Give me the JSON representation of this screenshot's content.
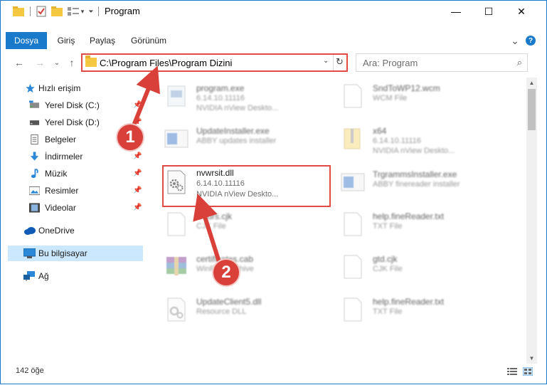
{
  "window": {
    "title": "Program",
    "minimize_glyph": "—",
    "maximize_glyph": "☐",
    "close_glyph": "✕"
  },
  "ribbon": {
    "tabs": [
      "Dosya",
      "Giriş",
      "Paylaş",
      "Görünüm"
    ],
    "accent": "#1979ca",
    "expand_glyph": "⌄",
    "help_glyph": "?"
  },
  "nav": {
    "back_glyph": "←",
    "forward_glyph": "→",
    "recent_glyph": "⌄",
    "up_glyph": "↑",
    "address": "C:\\Program Files\\Program Dizini",
    "address_dropdown_glyph": "⌄",
    "refresh_glyph": "↻",
    "search_placeholder": "Ara: Program",
    "search_glyph": "⌕"
  },
  "sidebar": {
    "items": [
      {
        "label": "Hızlı erişim",
        "icon": "star-icon"
      },
      {
        "label": "Yerel Disk (C:)",
        "icon": "drive-icon",
        "pinned": true
      },
      {
        "label": "Yerel Disk (D:)",
        "icon": "drive-icon",
        "pinned": true
      },
      {
        "label": "Belgeler",
        "icon": "documents-icon",
        "pinned": true
      },
      {
        "label": "İndirmeler",
        "icon": "download-icon",
        "pinned": true
      },
      {
        "label": "Müzik",
        "icon": "music-icon",
        "pinned": true
      },
      {
        "label": "Resimler",
        "icon": "pictures-icon",
        "pinned": true
      },
      {
        "label": "Videolar",
        "icon": "video-icon",
        "pinned": true
      },
      {
        "label": "OneDrive",
        "icon": "cloud-icon"
      },
      {
        "label": "Bu bilgisayar",
        "icon": "computer-icon",
        "selected": true
      },
      {
        "label": "Ağ",
        "icon": "network-icon"
      }
    ],
    "pin_glyph": "📌"
  },
  "files": {
    "left": [
      {
        "name": "program.exe",
        "line2": "6.14.10.11116",
        "line3": "NVIDIA nView Deskto...",
        "icon": "exe-icon"
      },
      {
        "name": "UpdateInstaller.exe",
        "line2": "ABBY updates installer",
        "line3": "",
        "icon": "installer-icon"
      },
      {
        "name": "nvwrsit.dll",
        "line2": "6.14.10.11116",
        "line3": "NVIDIA nView Deskto...",
        "icon": "dll-gear-icon",
        "highlighted": true
      },
      {
        "name": "Cours.cjk",
        "line2": "CJK File",
        "line3": "",
        "icon": "blank-file-icon"
      },
      {
        "name": "certificates.cab",
        "line2": "WinRAR archive",
        "line3": "",
        "icon": "rar-icon"
      },
      {
        "name": "UpdateClient5.dll",
        "line2": "Resource DLL",
        "line3": "",
        "icon": "dll-gear-icon"
      }
    ],
    "right": [
      {
        "name": "SndToWP12.wcm",
        "line2": "WCM File",
        "line3": "",
        "icon": "blank-file-icon"
      },
      {
        "name": "x64",
        "line2": "6.14.10.11116",
        "line3": "NVIDIA nView Deskto...",
        "icon": "zip-folder-icon"
      },
      {
        "name": "TrgrammsInstaller.exe",
        "line2": "ABBY finereader installer",
        "line3": "",
        "icon": "installer-icon"
      },
      {
        "name": "help.fineReader.txt",
        "line2": "TXT File",
        "line3": "",
        "icon": "blank-file-icon"
      },
      {
        "name": "gtd.cjk",
        "line2": "CJK File",
        "line3": "",
        "icon": "blank-file-icon"
      },
      {
        "name": "help.fineReader.txt",
        "line2": "TXT File",
        "line3": "",
        "icon": "blank-file-icon"
      }
    ]
  },
  "status": {
    "count": "142 öğe"
  },
  "annotations": {
    "badge1": "1",
    "badge2": "2",
    "color": "#d9403a"
  }
}
